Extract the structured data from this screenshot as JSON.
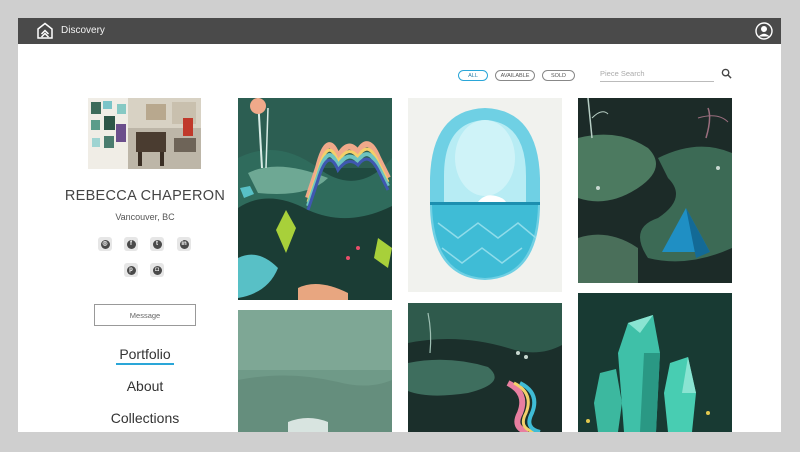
{
  "header": {
    "app_title": "Discovery",
    "logo_icon": "house-chevron-icon",
    "avatar_icon": "user-avatar-icon"
  },
  "filters": {
    "all": "ALL",
    "available": "AVAILABLE",
    "sold": "SOLD",
    "active": "ALL"
  },
  "search": {
    "placeholder": "Piece Search",
    "icon": "magnifier-icon"
  },
  "profile": {
    "name": "REBECCA CHAPERON",
    "location": "Vancouver, BC",
    "socials": [
      "globe-icon",
      "facebook-icon",
      "twitter-icon",
      "linkedin-icon",
      "pinterest-icon",
      "instagram-icon"
    ],
    "message_label": "Message"
  },
  "nav": {
    "portfolio": "Portfolio",
    "about": "About",
    "collections": "Collections",
    "active": "Portfolio"
  },
  "colors": {
    "topbar": "#4a4a4a",
    "accent": "#2aa6d8"
  }
}
